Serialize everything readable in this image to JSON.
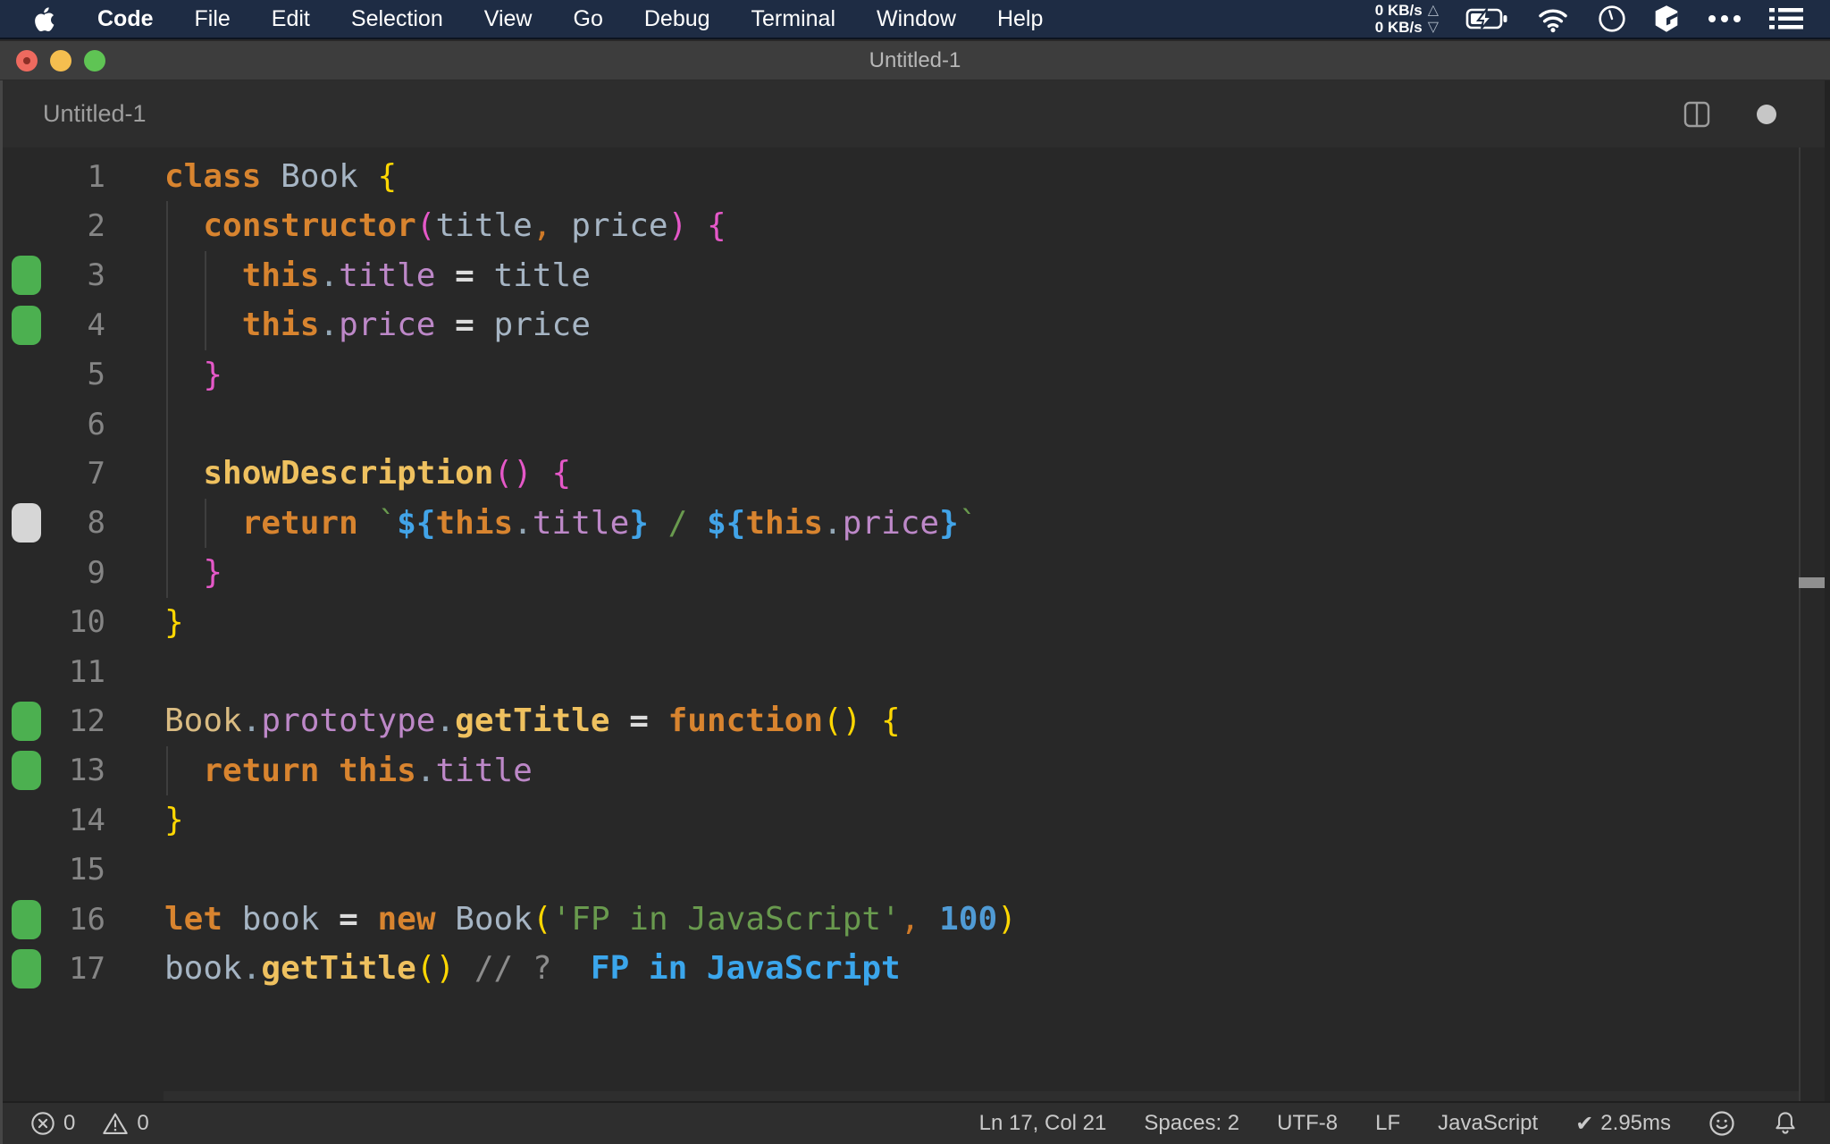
{
  "menu_bar": {
    "items": [
      "Code",
      "File",
      "Edit",
      "Selection",
      "View",
      "Go",
      "Debug",
      "Terminal",
      "Window",
      "Help"
    ],
    "net_up": "0 KB/s",
    "net_down": "0 KB/s",
    "icons": {
      "up_arrow": "△",
      "down_arrow": "▽"
    }
  },
  "title_bar": {
    "title": "Untitled-1"
  },
  "tab_bar": {
    "tab_title": "Untitled-1"
  },
  "editor": {
    "language": "JavaScript",
    "lines": [
      {
        "n": "1",
        "mark": null,
        "tokens": [
          [
            "kw",
            "class"
          ],
          [
            "txt",
            " "
          ],
          [
            "id",
            "Book"
          ],
          [
            "txt",
            " "
          ],
          [
            "p1",
            "{"
          ]
        ]
      },
      {
        "n": "2",
        "mark": null,
        "tokens": [
          [
            "txt",
            "  "
          ],
          [
            "kw",
            "constructor"
          ],
          [
            "p2",
            "("
          ],
          [
            "id",
            "title"
          ],
          [
            "cma",
            ","
          ],
          [
            "txt",
            " "
          ],
          [
            "id",
            "price"
          ],
          [
            "p2",
            ")"
          ],
          [
            "txt",
            " "
          ],
          [
            "p2",
            "{"
          ]
        ]
      },
      {
        "n": "3",
        "mark": "green",
        "tokens": [
          [
            "txt",
            "    "
          ],
          [
            "kw",
            "this"
          ],
          [
            "dot",
            "."
          ],
          [
            "prop",
            "title"
          ],
          [
            "txt",
            " "
          ],
          [
            "op",
            "="
          ],
          [
            "txt",
            " "
          ],
          [
            "id",
            "title"
          ]
        ]
      },
      {
        "n": "4",
        "mark": "green",
        "tokens": [
          [
            "txt",
            "    "
          ],
          [
            "kw",
            "this"
          ],
          [
            "dot",
            "."
          ],
          [
            "prop",
            "price"
          ],
          [
            "txt",
            " "
          ],
          [
            "op",
            "="
          ],
          [
            "txt",
            " "
          ],
          [
            "id",
            "price"
          ]
        ]
      },
      {
        "n": "5",
        "mark": null,
        "tokens": [
          [
            "txt",
            "  "
          ],
          [
            "p2",
            "}"
          ]
        ]
      },
      {
        "n": "6",
        "mark": null,
        "tokens": []
      },
      {
        "n": "7",
        "mark": null,
        "tokens": [
          [
            "txt",
            "  "
          ],
          [
            "fn",
            "showDescription"
          ],
          [
            "p2",
            "()"
          ],
          [
            "txt",
            " "
          ],
          [
            "p2",
            "{"
          ]
        ]
      },
      {
        "n": "8",
        "mark": "gray",
        "tokens": [
          [
            "txt",
            "    "
          ],
          [
            "kw",
            "return"
          ],
          [
            "txt",
            " "
          ],
          [
            "str",
            "`"
          ],
          [
            "p3",
            "${"
          ],
          [
            "kw",
            "this"
          ],
          [
            "dot",
            "."
          ],
          [
            "prop",
            "title"
          ],
          [
            "p3",
            "}"
          ],
          [
            "str",
            " / "
          ],
          [
            "p3",
            "${"
          ],
          [
            "kw",
            "this"
          ],
          [
            "dot",
            "."
          ],
          [
            "prop",
            "price"
          ],
          [
            "p3",
            "}"
          ],
          [
            "str",
            "`"
          ]
        ]
      },
      {
        "n": "9",
        "mark": null,
        "tokens": [
          [
            "txt",
            "  "
          ],
          [
            "p2",
            "}"
          ]
        ]
      },
      {
        "n": "10",
        "mark": null,
        "tokens": [
          [
            "p1",
            "}"
          ]
        ]
      },
      {
        "n": "11",
        "mark": null,
        "tokens": []
      },
      {
        "n": "12",
        "mark": "green",
        "tokens": [
          [
            "cls",
            "Book"
          ],
          [
            "dot",
            "."
          ],
          [
            "prop",
            "prototype"
          ],
          [
            "dot",
            "."
          ],
          [
            "fn",
            "getTitle"
          ],
          [
            "txt",
            " "
          ],
          [
            "op",
            "="
          ],
          [
            "txt",
            " "
          ],
          [
            "kw",
            "function"
          ],
          [
            "p1",
            "()"
          ],
          [
            "txt",
            " "
          ],
          [
            "p1",
            "{"
          ]
        ]
      },
      {
        "n": "13",
        "mark": "green",
        "tokens": [
          [
            "txt",
            "  "
          ],
          [
            "kw",
            "return"
          ],
          [
            "txt",
            " "
          ],
          [
            "kw",
            "this"
          ],
          [
            "dot",
            "."
          ],
          [
            "prop",
            "title"
          ]
        ]
      },
      {
        "n": "14",
        "mark": null,
        "tokens": [
          [
            "p1",
            "}"
          ]
        ]
      },
      {
        "n": "15",
        "mark": null,
        "tokens": []
      },
      {
        "n": "16",
        "mark": "green",
        "tokens": [
          [
            "kw",
            "let"
          ],
          [
            "txt",
            " "
          ],
          [
            "id",
            "book"
          ],
          [
            "txt",
            " "
          ],
          [
            "op",
            "="
          ],
          [
            "txt",
            " "
          ],
          [
            "kw",
            "new"
          ],
          [
            "txt",
            " "
          ],
          [
            "id",
            "Book"
          ],
          [
            "p1",
            "("
          ],
          [
            "str",
            "'FP in JavaScript'"
          ],
          [
            "cma",
            ","
          ],
          [
            "txt",
            " "
          ],
          [
            "num",
            "100"
          ],
          [
            "p1",
            ")"
          ]
        ]
      },
      {
        "n": "17",
        "mark": "green",
        "current": true,
        "tokens": [
          [
            "id",
            "book"
          ],
          [
            "dot",
            "."
          ],
          [
            "fn",
            "getTitle"
          ],
          [
            "p1",
            "()"
          ],
          [
            "txt",
            " "
          ],
          [
            "cm",
            "// ?"
          ],
          [
            "txt",
            "  "
          ],
          [
            "out",
            "FP in JavaScript"
          ]
        ]
      }
    ],
    "colors": {
      "background": "#282828",
      "git_added": "#4cb050",
      "git_modified": "#d6d6d6",
      "keyword": "#d8842f",
      "property": "#bd88c8",
      "function_name": "#efc15f",
      "string": "#699a4e",
      "number": "#509bd5",
      "bracket_level1": "#ffd702",
      "bracket_level2": "#e558c8",
      "bracket_level3": "#42a4e8",
      "quokka_output": "#3ba6ec"
    }
  },
  "status_bar": {
    "errors": "0",
    "warnings": "0",
    "cursor": "Ln 17, Col 21",
    "indentation": "Spaces: 2",
    "encoding": "UTF-8",
    "eol": "LF",
    "language": "JavaScript",
    "perf": "2.95ms",
    "icons": {
      "check": "✔"
    }
  }
}
